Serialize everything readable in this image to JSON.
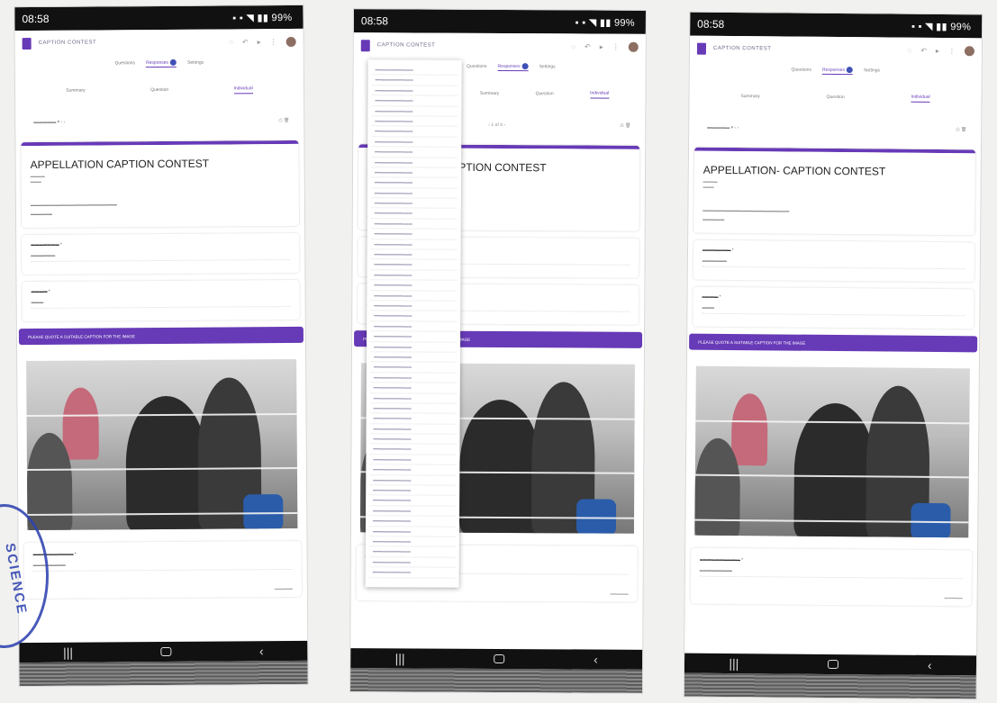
{
  "screens": [
    {
      "status": {
        "time": "08:58",
        "right": "99%"
      },
      "app_title": "CAPTION CONTEST",
      "tabs": [
        "Questions",
        "Responses",
        "Settings"
      ],
      "subtabs": [
        "Summary",
        "Question",
        "Individual"
      ],
      "form_title": "APPELLATION  CAPTION CONTEST",
      "section_header": "PLEASE QUOTE A SUITABLE CAPTION FOR THE IMAGE",
      "show_dropdown": false
    },
    {
      "status": {
        "time": "08:58",
        "right": "99%"
      },
      "app_title": "CAPTION CONTEST",
      "tabs": [
        "Questions",
        "Responses",
        "Settings"
      ],
      "subtabs": [
        "Summary",
        "Question",
        "Individual"
      ],
      "form_title": "APPELLATION  CAPTION CONTEST",
      "section_header": "PLEASE QUOTE A SUITABLE CAPTION FOR THE IMAGE",
      "show_dropdown": true
    },
    {
      "status": {
        "time": "08:58",
        "right": "99%"
      },
      "app_title": "CAPTION CONTEST",
      "tabs": [
        "Questions",
        "Responses",
        "Settings"
      ],
      "subtabs": [
        "Summary",
        "Question",
        "Individual"
      ],
      "form_title": "APPELLATION- CAPTION CONTEST",
      "section_header": "PLEASE QUOTE A SUITABLE CAPTION FOR THE IMAGE",
      "show_dropdown": false
    }
  ],
  "stamp_text": "SCIENCE",
  "accent_color": "#673ab7"
}
